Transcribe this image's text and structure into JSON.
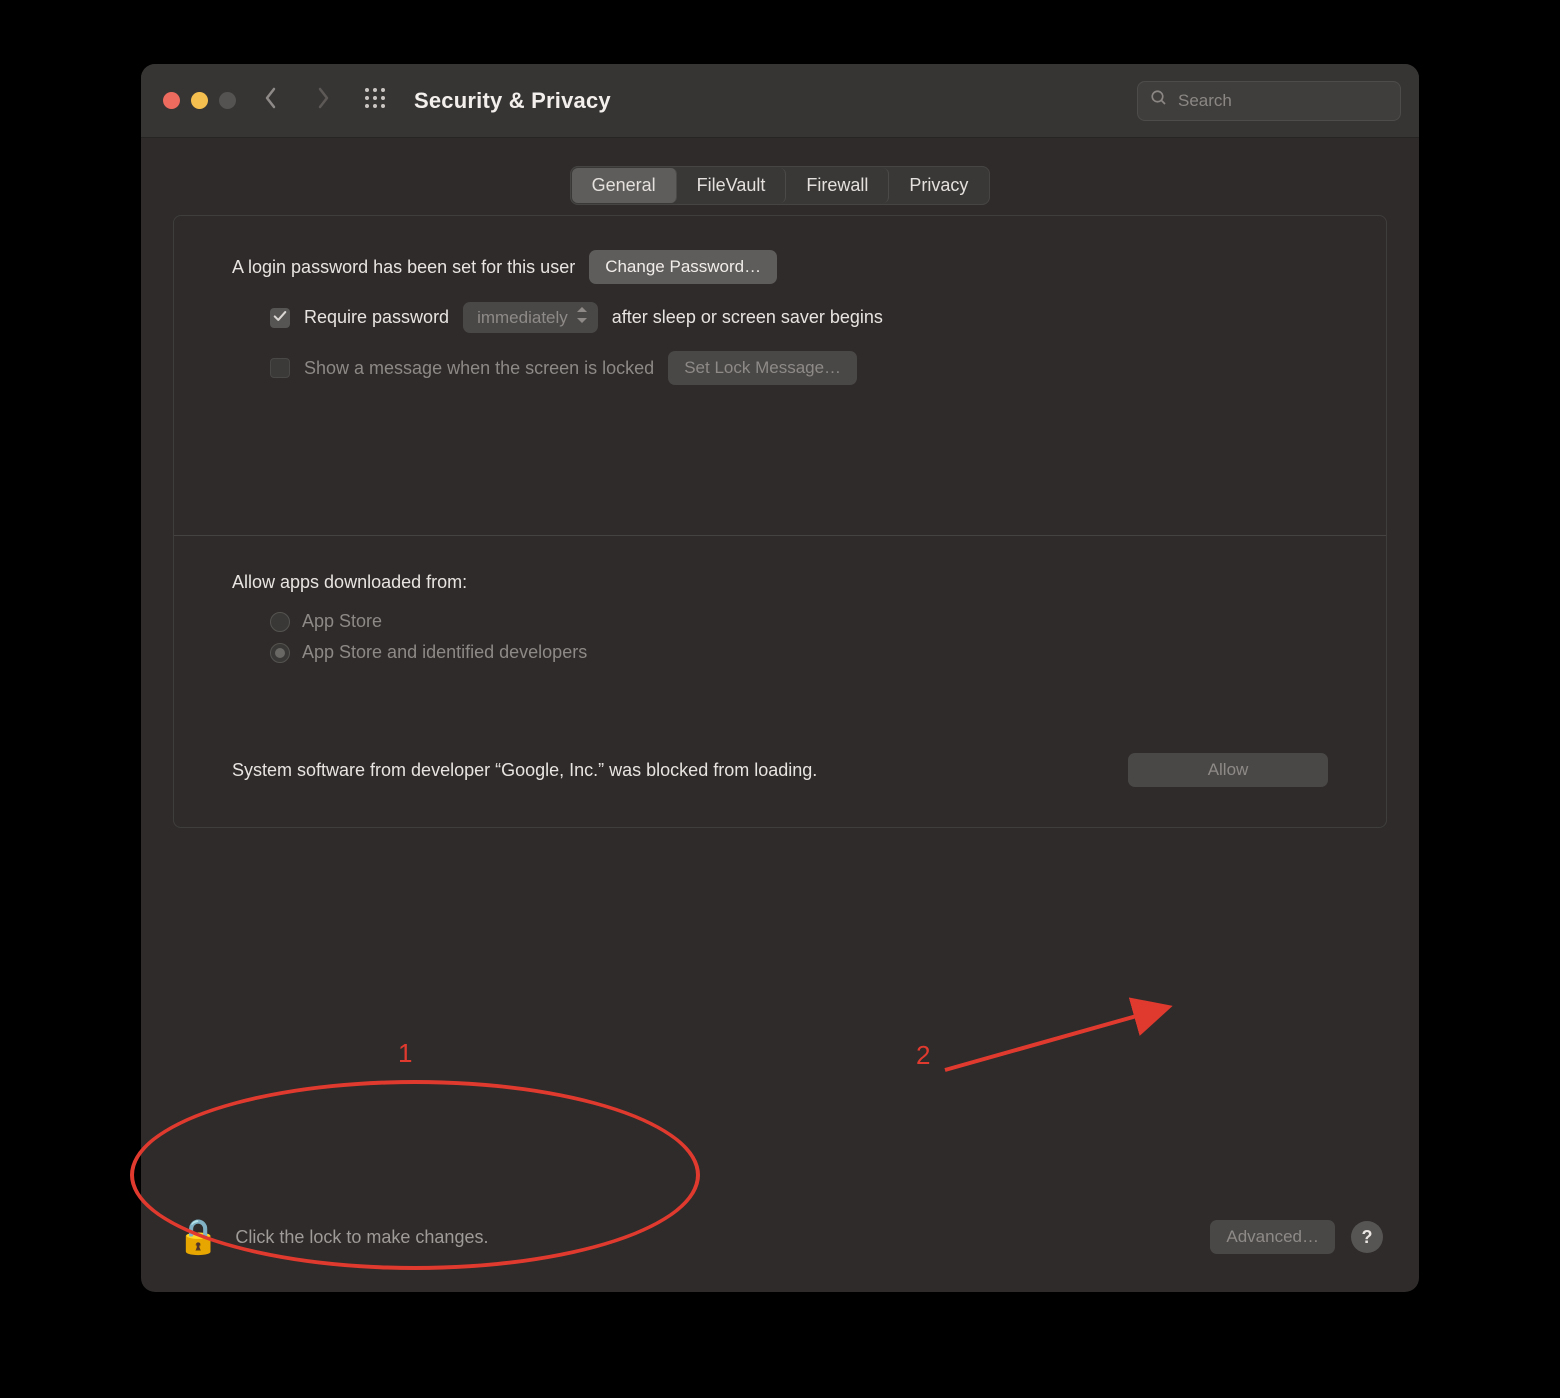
{
  "window": {
    "title": "Security & Privacy",
    "search_placeholder": "Search"
  },
  "tabs": [
    {
      "label": "General",
      "active": true
    },
    {
      "label": "FileVault",
      "active": false
    },
    {
      "label": "Firewall",
      "active": false
    },
    {
      "label": "Privacy",
      "active": false
    }
  ],
  "general": {
    "login_password_text": "A login password has been set for this user",
    "change_password_btn": "Change Password…",
    "require_password_label": "Require password",
    "require_password_delay": "immediately",
    "require_password_suffix": "after sleep or screen saver begins",
    "show_lock_message_label": "Show a message when the screen is locked",
    "set_lock_message_btn": "Set Lock Message…",
    "allow_apps_heading": "Allow apps downloaded from:",
    "radio_options": [
      {
        "label": "App Store",
        "checked": false
      },
      {
        "label": "App Store and identified developers",
        "checked": true
      }
    ],
    "blocked_text": "System software from developer “Google, Inc.” was blocked from loading.",
    "allow_btn": "Allow"
  },
  "footer": {
    "lock_text": "Click the lock to make changes.",
    "advanced_btn": "Advanced…",
    "help_label": "?"
  },
  "annotations": {
    "num1": "1",
    "num2": "2"
  },
  "colors": {
    "annotation_red": "#e03a2f"
  }
}
